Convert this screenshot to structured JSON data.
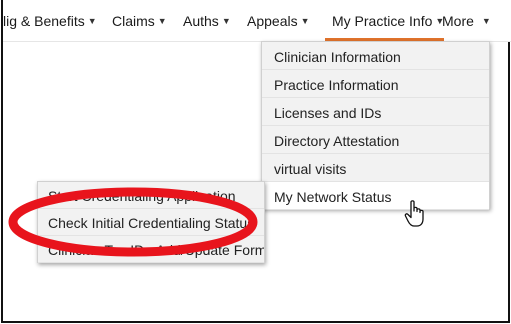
{
  "nav": {
    "items": [
      {
        "label": "lig & Benefits"
      },
      {
        "label": "Claims"
      },
      {
        "label": "Auths"
      },
      {
        "label": "Appeals"
      },
      {
        "label": "My Practice Info",
        "active": true
      },
      {
        "label": "More"
      }
    ]
  },
  "practice_menu": {
    "items": [
      {
        "label": "Clinician Information"
      },
      {
        "label": "Practice Information"
      },
      {
        "label": "Licenses and IDs"
      },
      {
        "label": "Directory Attestation"
      },
      {
        "label": "virtual visits"
      },
      {
        "label": "My Network Status",
        "active": true
      }
    ]
  },
  "claims_submenu": {
    "items": [
      {
        "label": "Start Credentialing Application"
      },
      {
        "label": "Check Initial Credentialing Status"
      },
      {
        "label": "Clinician Tax ID - Add/Update Form"
      }
    ]
  },
  "colors": {
    "accent": "#e0732c",
    "annotation": "#e8141c"
  },
  "icons": {
    "cursor": "hand-pointer-icon",
    "caret": "caret-down-icon"
  }
}
